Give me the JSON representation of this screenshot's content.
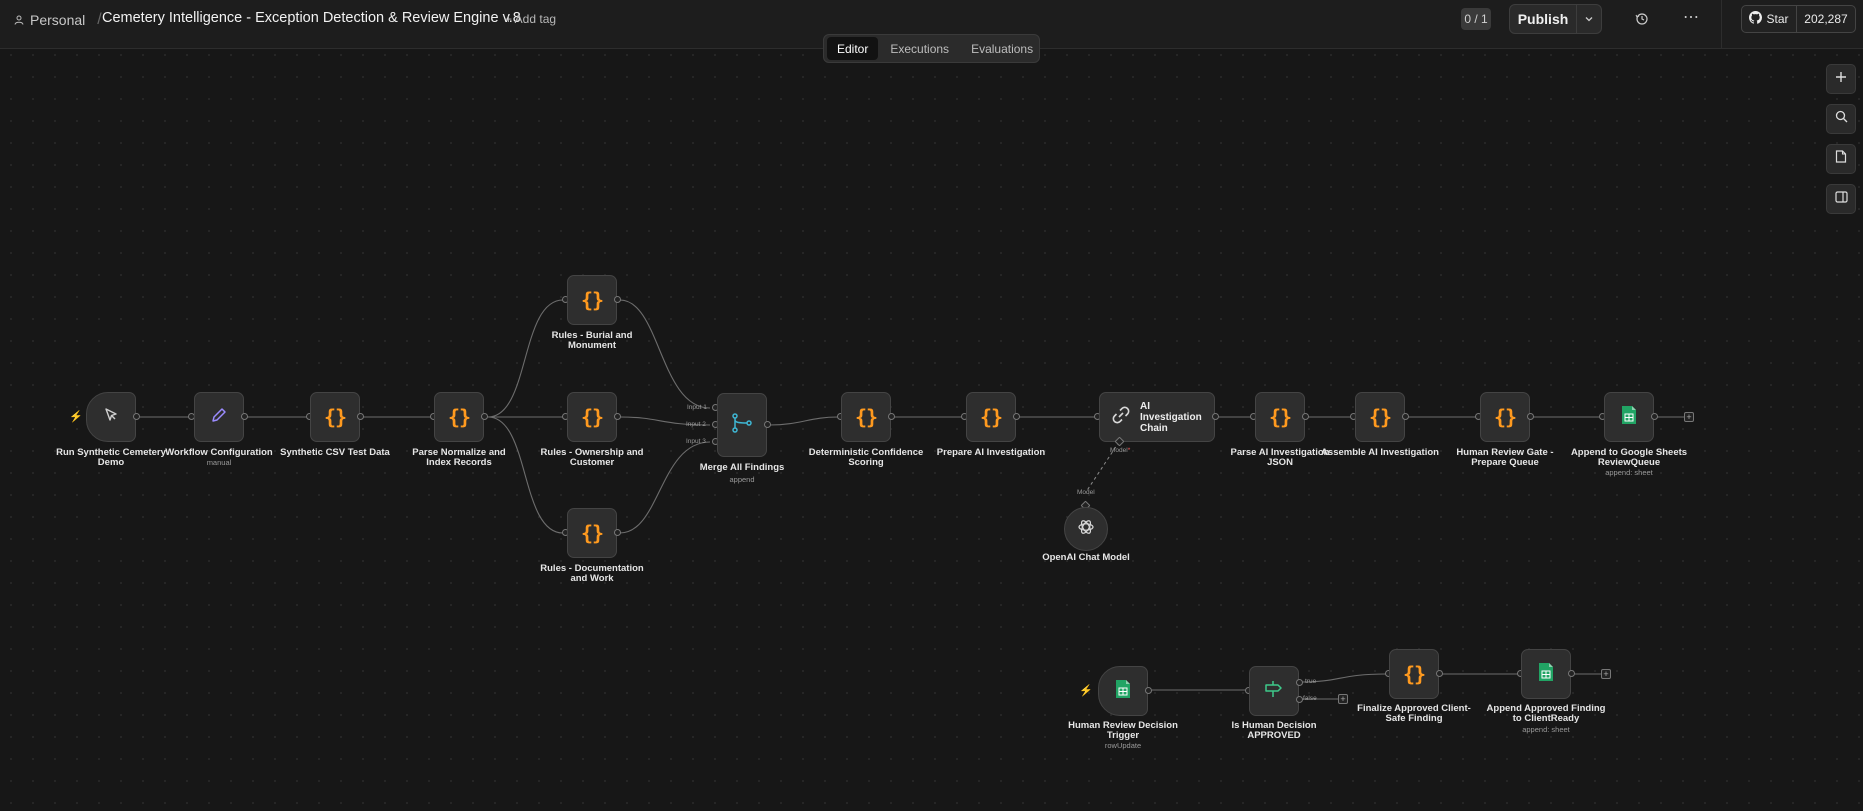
{
  "header": {
    "workspace": "Personal",
    "workflow_title": "Cemetery Intelligence - Exception Detection & Review Engine v.8",
    "add_tag": "+ Add tag",
    "counter": "0 / 1",
    "publish": "Publish",
    "github_star": "Star",
    "github_count": "202,287"
  },
  "tabs": [
    "Editor",
    "Executions",
    "Evaluations"
  ],
  "nodes": {
    "run_demo": {
      "label": "Run Synthetic Cemetery Demo",
      "icon": "cursor-icon"
    },
    "workflow_config": {
      "label": "Workflow Configuration",
      "sub": "manual",
      "icon": "pencil-icon"
    },
    "synthetic_csv": {
      "label": "Synthetic CSV Test Data",
      "icon": "code-icon"
    },
    "parse_normalize": {
      "label": "Parse Normalize and Index Records",
      "icon": "code-icon"
    },
    "rules_burial": {
      "label": "Rules - Burial and Monument",
      "icon": "code-icon"
    },
    "rules_ownership": {
      "label": "Rules - Ownership and Customer",
      "icon": "code-icon"
    },
    "rules_documentation": {
      "label": "Rules - Documentation and Work",
      "icon": "code-icon"
    },
    "merge": {
      "label": "Merge All Findings",
      "sub": "append",
      "icon": "merge-icon",
      "inputs": [
        "Input 1",
        "Input 2",
        "Input 3"
      ]
    },
    "confidence": {
      "label": "Deterministic Confidence Scoring",
      "icon": "code-icon"
    },
    "prepare_ai": {
      "label": "Prepare AI Investigation",
      "icon": "code-icon"
    },
    "ai_chain": {
      "label": "AI Investigation Chain",
      "icon": "link-icon",
      "port_label": "Model"
    },
    "openai": {
      "label": "OpenAI Chat Model",
      "icon": "openai-icon",
      "port_label": "Model"
    },
    "parse_ai": {
      "label": "Parse AI Investigation JSON",
      "icon": "code-icon"
    },
    "assemble_ai": {
      "label": "Assemble AI Investigation",
      "icon": "code-icon"
    },
    "review_gate": {
      "label": "Human Review Gate - Prepare Queue",
      "icon": "code-icon"
    },
    "append_sheets": {
      "label": "Append to Google Sheets ReviewQueue",
      "sub": "append: sheet",
      "icon": "sheets-icon"
    },
    "review_trigger": {
      "label": "Human Review Decision Trigger",
      "sub": "rowUpdate",
      "icon": "sheets-icon"
    },
    "is_approved": {
      "label": "Is Human Decision APPROVED",
      "icon": "if-icon",
      "branches": [
        "true",
        "false"
      ]
    },
    "finalize": {
      "label": "Finalize Approved Client-Safe Finding",
      "icon": "code-icon"
    },
    "append_approved": {
      "label": "Append Approved Finding to ClientReady",
      "sub": "append: sheet",
      "icon": "sheets-icon"
    }
  },
  "colors": {
    "accent_code": "#ff9a1f",
    "sheets_green": "#21a464",
    "merge_teal": "#3fb7d4",
    "pencil_purple": "#9b8cff",
    "trigger_bolt": "#ff5b3a"
  }
}
